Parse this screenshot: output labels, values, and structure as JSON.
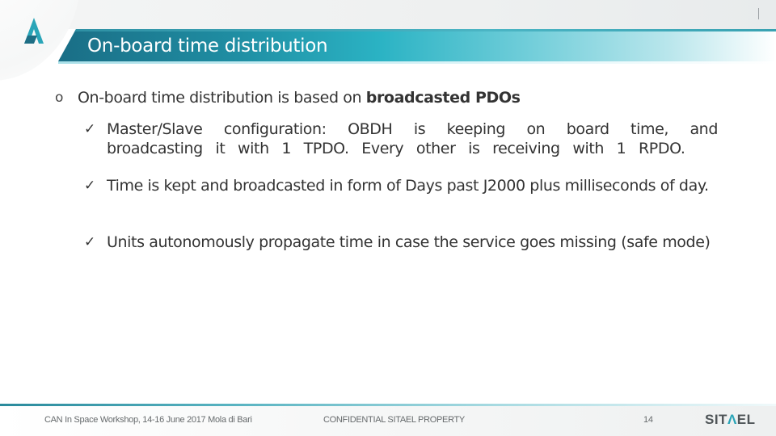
{
  "slide": {
    "title": "On-board time distribution",
    "logo_icon": "sitael-a-logo-icon",
    "accent_color": "#1f8ea3"
  },
  "body": {
    "main_bullet": {
      "marker": "o",
      "text_prefix": "On-board time distribution is based on ",
      "text_bold": "broadcasted PDOs"
    },
    "sub_bullets": [
      {
        "marker": "✓",
        "text": "Master/Slave configuration: OBDH is keeping on board time, and broadcasting it with 1 TPDO. Every other is receiving with 1 RPDO."
      },
      {
        "marker": "✓",
        "text": "Time is kept and broadcasted in form of Days past J2000 plus milliseconds of day."
      },
      {
        "marker": "✓",
        "text": "Units autonomously propagate time in case the service goes missing (safe mode)"
      }
    ]
  },
  "footer": {
    "event": "CAN In Space Workshop, 14-16 June 2017 Mola di Bari",
    "confidential": "CONFIDENTIAL SITAEL PROPERTY",
    "page_number": "14",
    "brand_pre": "SIT",
    "brand_accent": "Λ",
    "brand_post": "EL"
  }
}
